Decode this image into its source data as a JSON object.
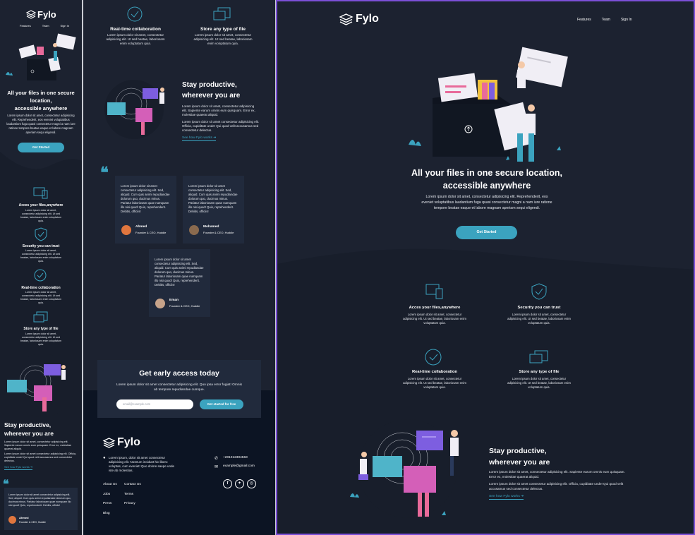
{
  "brand": {
    "name": "Fylo"
  },
  "nav": {
    "features": "Features",
    "team": "Team",
    "signin": "Sign In"
  },
  "hero": {
    "title_line1": "All your files in one secure location,",
    "title_line2": "accessible anywhere",
    "mobile_title_1": "All your files in one secure",
    "mobile_title_2": "location,",
    "mobile_title_3": "accessible anywhere",
    "body": "Lorem ipsum dolor sit amet, consectetur adipisicing elit. Reprehenderit, eos eveniet voluptatibus laudantium fuga quasi consectetur magni a nam iure ratione tempore beatae eaque et labore magnam aperiam sequi eligendi.",
    "cta": "Get Started"
  },
  "features": [
    {
      "title": "Acces your files,anywhere",
      "body": "Lorem ipsum dolor sit amet, consectetur adipisicing elit. Ut sed beatae, laboriosam enim voluptatum quia.",
      "icon": "access-anywhere-icon"
    },
    {
      "title": "Security you can trust",
      "body": "Lorem ipsum dolor sit amet, consectetur adipisicing elit. Ut sed beatae, laboriosam enim voluptatum quia.",
      "icon": "shield-icon"
    },
    {
      "title": "Real-time collaboration",
      "body": "Lorem ipsum dolor sit amet, consectetur adipisicing elit. Ut sed beatae, laboriosam enim voluptatum quia.",
      "icon": "collaboration-icon"
    },
    {
      "title": "Store any type of file",
      "body": "Lorem ipsum dolor sit amet, consectetur adipisicing elit. Ut sed beatae, laboriosam enim voluptatum quia.",
      "icon": "folders-icon"
    }
  ],
  "productive": {
    "title_1": "Stay productive,",
    "title_2": "wherever you are",
    "p1": "Lorem ipsum dolor sit amet, consectetur adipisicing elit. Sapiente earum omnis eum quisquam. Error ex, molestiae quaerat aliquid.",
    "p2": "Lorem ipsum dolor sit amet consectetur adipisicing elit. Officia, cupiditate unde! Qui quod velit accusamus sed consectetur delectus.",
    "link": "See how Fylo works"
  },
  "testimonials": [
    {
      "body": "Lorem ipsum dolor sit amet consectetur adipisicing elit. Sed, aliquid. Cum quis animi repudiandae dolorum quo, ducimus minus. Pariatur laboriosam quae numquam illo nisi quod! Quis, reprehenderit. Debitis, officiis!",
      "name": "Ahmed",
      "role": "Founder & CEO, Huddle"
    },
    {
      "body": "Lorem ipsum dolor sit amet consectetur adipisicing elit. Sed, aliquid. Cum quis animi repudiandae dolorum quo, ducimus minus. Pariatur laboriosam quae numquam illo nisi quod! Quis, reprehenderit. Debitis, officiis!",
      "name": "Mohamed",
      "role": "Founder & CEO, Huddle"
    },
    {
      "body": "Lorem ipsum dolor sit amet consectetur adipisicing elit. Sed, aliquid. Cum quis animi repudiandae dolorum quo, ducimus minus. Pariatur laboriosam quae numquam illo nisi quod! Quis, reprehenderit. Debitis, officiis!",
      "name": "Eman",
      "role": "Founder & CEO, Huddle"
    }
  ],
  "early": {
    "title": "Get early access today",
    "body_1": "Lorem ipsum dolor sit amet consectetur adipisicing elit. Quo ipsa error fugiat! Omnis",
    "body_2": "ab tempore repudiandae cumque.",
    "placeholder": "email@example.com",
    "cta": "Get started for free"
  },
  "footer": {
    "address": "Lorem ipsum, dolor sit amet consectetur adipisicing elit. Nostrum incidunt hic libero voluptas, cum eveniet! Quo dolore saepe unde iste ab molestias.",
    "phone": "+201012304563",
    "email": "example@gmail.com",
    "links_col1": [
      "About Us",
      "Jobs",
      "Press",
      "Blog"
    ],
    "links_col2": [
      "Contact Us",
      "Terms",
      "Privacy"
    ]
  },
  "colors": {
    "background": "#1c2230",
    "footer": "#0c1423",
    "card": "#212a3c",
    "accent": "#3ba3bf",
    "selection": "#7b4fd6"
  }
}
